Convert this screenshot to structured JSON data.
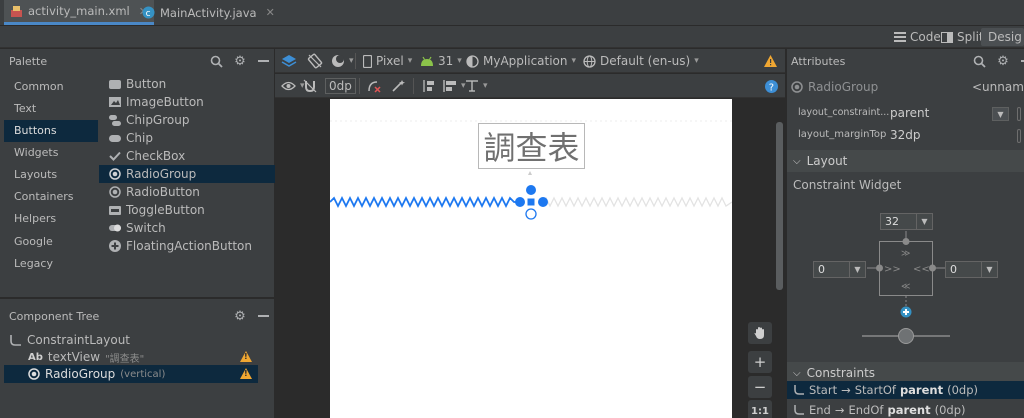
{
  "tabs": [
    {
      "label": "activity_main.xml",
      "active": true
    },
    {
      "label": "MainActivity.java",
      "active": false
    }
  ],
  "view_modes": {
    "code": "Code",
    "split": "Split",
    "design": "Desig"
  },
  "palette": {
    "title": "Palette",
    "categories": [
      "Common",
      "Text",
      "Buttons",
      "Widgets",
      "Layouts",
      "Containers",
      "Helpers",
      "Google",
      "Legacy"
    ],
    "selected_category": "Buttons",
    "items": [
      "Button",
      "ImageButton",
      "ChipGroup",
      "Chip",
      "CheckBox",
      "RadioGroup",
      "RadioButton",
      "ToggleButton",
      "Switch",
      "FloatingActionButton"
    ],
    "selected_item": "RadioGroup"
  },
  "component_tree": {
    "title": "Component Tree",
    "root": "ConstraintLayout",
    "children": [
      {
        "badge": "Ab",
        "label": "textView",
        "hint": "\"調查表\"",
        "warning": true
      },
      {
        "label": "RadioGroup",
        "hint": "(vertical)",
        "warning": true,
        "selected": true
      }
    ]
  },
  "design_toolbar": {
    "device": "Pixel",
    "api": "31",
    "theme": "MyApplication",
    "locale": "Default (en-us)",
    "margin": "0dp"
  },
  "canvas": {
    "text_view": "調查表",
    "zoom_ratio": "1:1"
  },
  "attributes": {
    "title": "Attributes",
    "widget": "RadioGroup",
    "id_value": "<unnamed>",
    "rows": [
      {
        "name": "layout_constraint...",
        "value": "parent"
      },
      {
        "name": "layout_marginTop",
        "value": "32dp"
      }
    ],
    "layout_section": "Layout",
    "constraint_widget_label": "Constraint Widget",
    "margin_top": "32",
    "margin_start": "0",
    "margin_end": "0",
    "constraints_section": "Constraints",
    "constraints": [
      {
        "name": "Start",
        "arrow": "→",
        "target": "StartOf",
        "parent": "parent",
        "value": "(0dp)"
      },
      {
        "name": "End",
        "arrow": "→",
        "target": "EndOf",
        "parent": "parent",
        "value": "(0dp)"
      }
    ]
  },
  "colors": {
    "accent": "#4a88c7",
    "blue": "#1d78f0",
    "warning": "#f0a732",
    "selection": "#0d293e"
  }
}
